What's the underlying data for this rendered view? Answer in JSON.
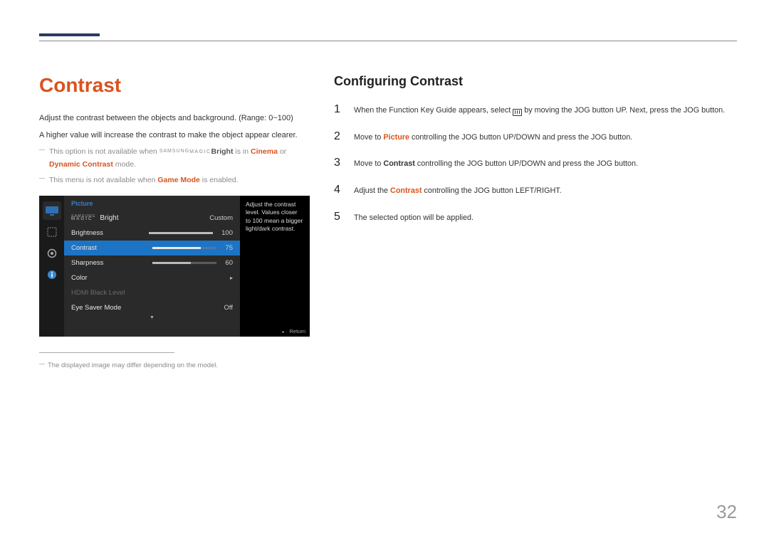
{
  "page": {
    "title": "Contrast",
    "subtitle": "Configuring Contrast",
    "page_number": "32"
  },
  "intro": {
    "line1": "Adjust the contrast between the objects and background. (Range: 0~100)",
    "line2": "A higher value will increase the contrast to make the object appear clearer."
  },
  "notes": {
    "n1_a": "This option is not available when ",
    "n1_brand_sup": "SAMSUNG",
    "n1_brand_main": "MAGIC",
    "n1_bright": "Bright",
    "n1_b": " is in ",
    "n1_cinema": "Cinema",
    "n1_c": " or ",
    "n1_dyn": "Dynamic Contrast",
    "n1_d": " mode.",
    "n2_a": "This menu is not available when ",
    "n2_game": "Game Mode",
    "n2_b": " is enabled."
  },
  "osd": {
    "header": "Picture",
    "magic_top": "SAMSUNG",
    "magic_bot": "MAGIC",
    "bright_label": "Bright",
    "rows": {
      "custom": "Custom",
      "brightness_label": "Brightness",
      "brightness_val": "100",
      "contrast_label": "Contrast",
      "contrast_val": "75",
      "sharpness_label": "Sharpness",
      "sharpness_val": "60",
      "color_label": "Color",
      "hdmi_label": "HDMI Black Level",
      "eyesaver_label": "Eye Saver Mode",
      "eyesaver_val": "Off"
    },
    "help_text": "Adjust the contrast level. Values closer to 100 mean a bigger light/dark contrast.",
    "return_label": "Return"
  },
  "caption": "The displayed image may differ depending on the model.",
  "steps": {
    "s1_a": "When the Function Key Guide appears, select ",
    "s1_b": " by moving the JOG button UP. Next, press the JOG button.",
    "s2_a": "Move to ",
    "s2_pic": "Picture",
    "s2_b": " controlling the JOG button UP/DOWN and press the JOG button.",
    "s3_a": "Move to ",
    "s3_con": "Contrast",
    "s3_b": " controlling the JOG button UP/DOWN and press the JOG button.",
    "s4_a": "Adjust the ",
    "s4_con": "Contrast",
    "s4_b": " controlling the JOG button LEFT/RIGHT.",
    "s5": "The selected option will be applied."
  },
  "step_nums": {
    "n1": "1",
    "n2": "2",
    "n3": "3",
    "n4": "4",
    "n5": "5"
  }
}
